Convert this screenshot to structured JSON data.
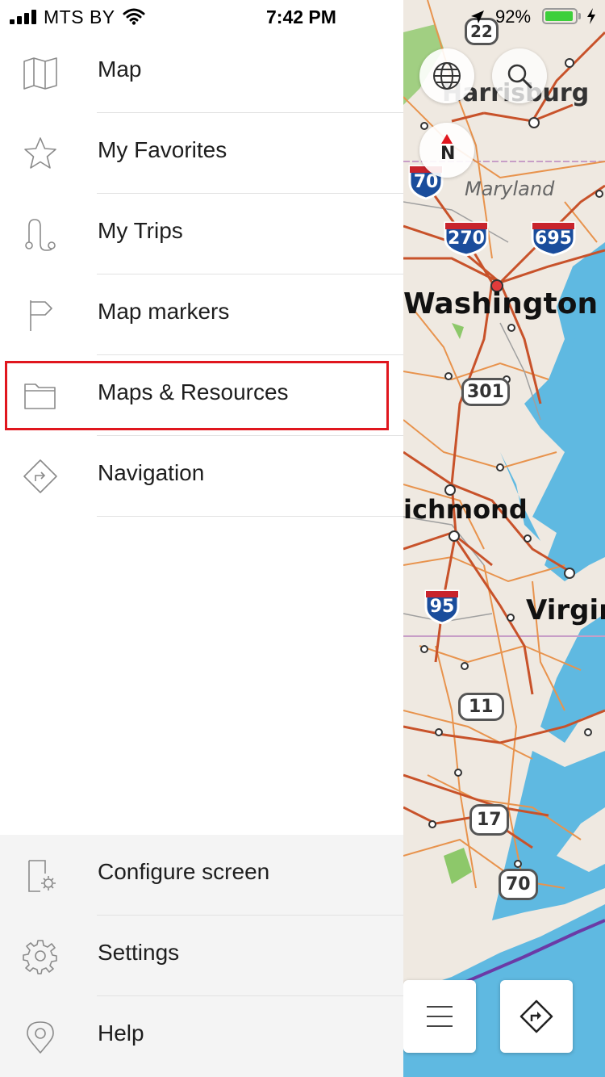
{
  "status_bar": {
    "carrier": "MTS BY",
    "time": "7:42 PM",
    "battery_percent": "92%",
    "battery_level": 0.92
  },
  "menu": {
    "items": [
      {
        "label": "Map",
        "icon": "map-icon"
      },
      {
        "label": "My Favorites",
        "icon": "star-icon"
      },
      {
        "label": "My Trips",
        "icon": "route-icon"
      },
      {
        "label": "Map markers",
        "icon": "flag-icon"
      },
      {
        "label": "Maps & Resources",
        "icon": "folder-icon",
        "highlighted": true
      },
      {
        "label": "Navigation",
        "icon": "navigation-icon"
      }
    ],
    "bottom_items": [
      {
        "label": "Configure screen",
        "icon": "configure-screen-icon"
      },
      {
        "label": "Settings",
        "icon": "gear-icon"
      },
      {
        "label": "Help",
        "icon": "help-pin-icon"
      }
    ]
  },
  "map": {
    "labels": {
      "harrisburg": "Harrisburg",
      "maryland": "Maryland",
      "washington": "Washington",
      "richmond": "ichmond",
      "virginia": "Virgin"
    },
    "shields": {
      "us22": "22",
      "i70": "70",
      "i270": "270",
      "i695": "695",
      "us301": "301",
      "i95": "95",
      "us11": "11",
      "us17": "17",
      "us70": "70"
    },
    "compass_label": "N",
    "colors": {
      "water": "#5fb9e1",
      "land": "#efe9e1",
      "major_road": "#c8522a",
      "minor_road": "#e8934d",
      "interstate_blue": "#1a4d9c",
      "interstate_red": "#c8232c",
      "park_green": "#8dc86a",
      "highlight_red": "#e0161e"
    }
  }
}
